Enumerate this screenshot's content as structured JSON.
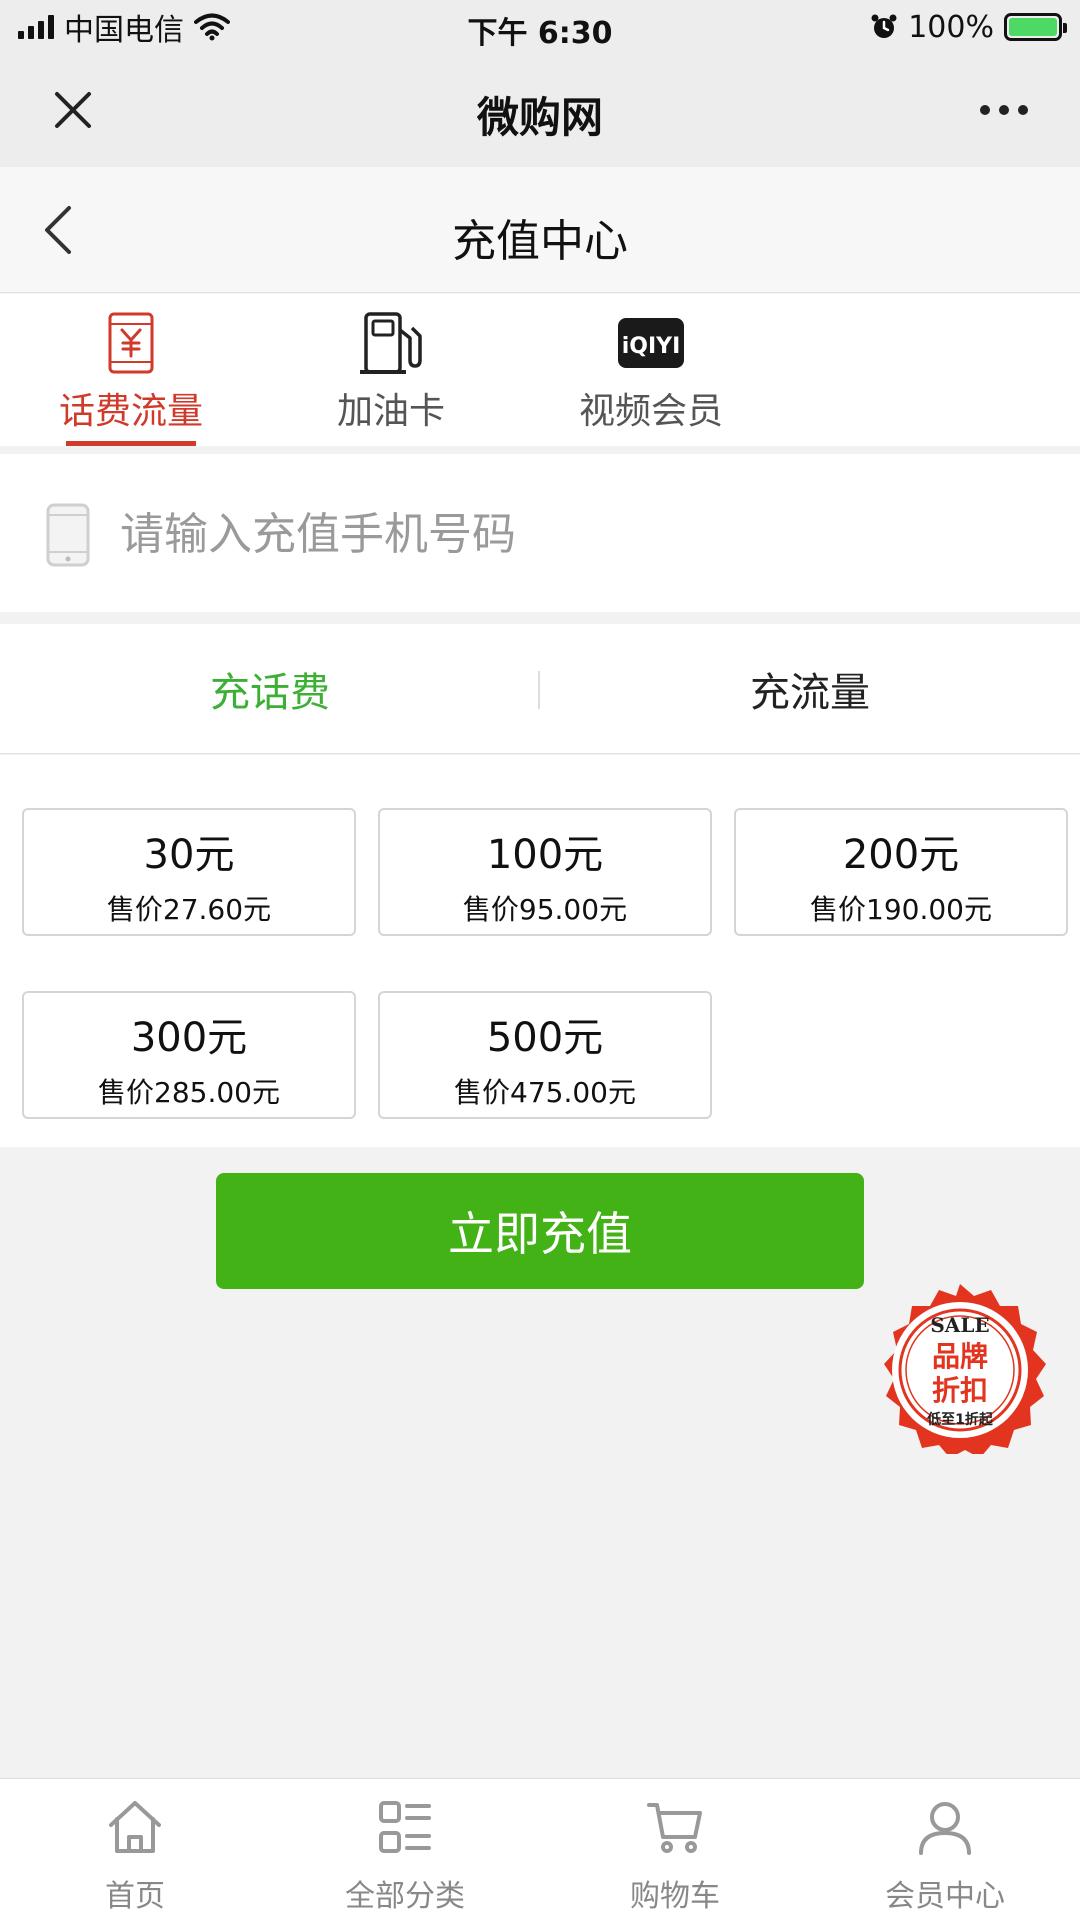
{
  "status_bar": {
    "carrier": "中国电信",
    "time": "下午 6:30",
    "battery": "100%"
  },
  "wechat_nav": {
    "title": "微购网"
  },
  "page_header": {
    "title": "充值中心"
  },
  "category_tabs": [
    {
      "label": "话费流量",
      "icon": "phone-yuan-icon",
      "active": true
    },
    {
      "label": "加油卡",
      "icon": "fuel-pump-icon",
      "active": false
    },
    {
      "label": "视频会员",
      "icon": "iqiyi-logo-icon",
      "active": false
    }
  ],
  "phone_input": {
    "placeholder": "请输入充值手机号码",
    "value": ""
  },
  "recharge_types": [
    {
      "label": "充话费",
      "active": true
    },
    {
      "label": "充流量",
      "active": false
    }
  ],
  "options": [
    {
      "face": "30元",
      "price": "售价27.60元"
    },
    {
      "face": "100元",
      "price": "售价95.00元"
    },
    {
      "face": "200元",
      "price": "售价190.00元"
    },
    {
      "face": "300元",
      "price": "售价285.00元"
    },
    {
      "face": "500元",
      "price": "售价475.00元"
    }
  ],
  "submit": {
    "label": "立即充值"
  },
  "sale_badge": {
    "top": "SALE",
    "line1": "品牌",
    "line2": "折扣",
    "bottom": "低至1折起"
  },
  "bottom_nav": [
    {
      "label": "首页",
      "icon": "home-icon"
    },
    {
      "label": "全部分类",
      "icon": "category-list-icon"
    },
    {
      "label": "购物车",
      "icon": "cart-icon"
    },
    {
      "label": "会员中心",
      "icon": "user-icon"
    }
  ],
  "colors": {
    "accent_red": "#d03a2a",
    "accent_green": "#3cb034",
    "button_green": "#42b216"
  }
}
